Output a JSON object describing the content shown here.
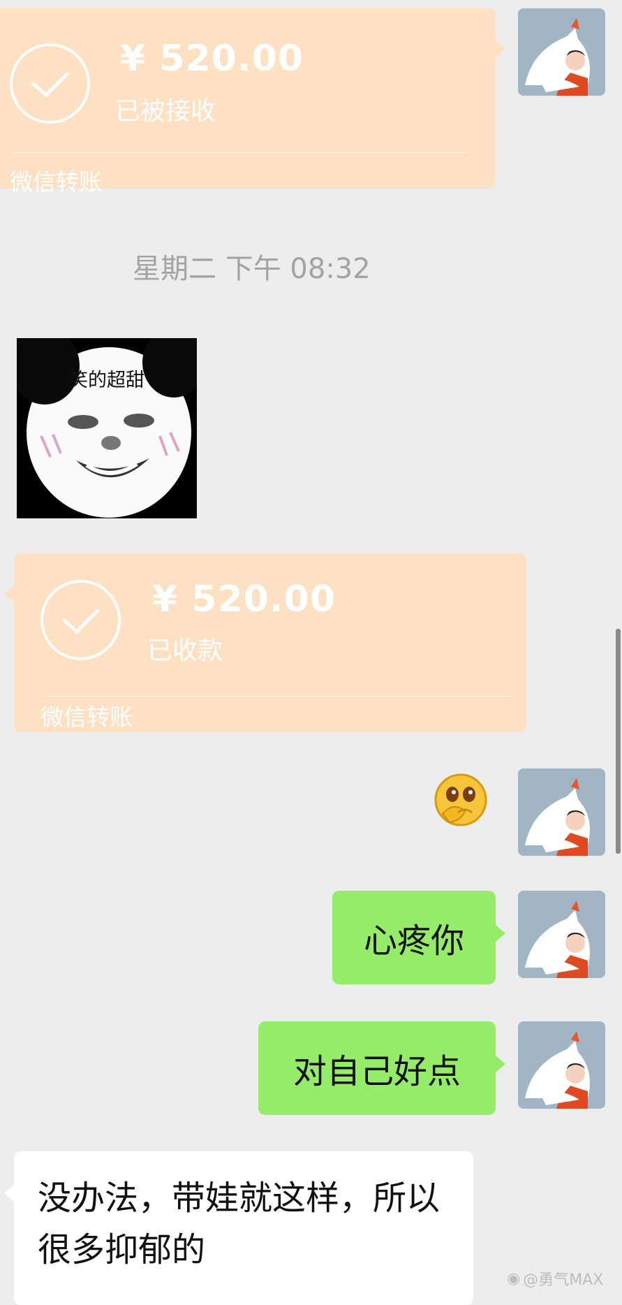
{
  "transfer_sent": {
    "amount": "¥ 520.00",
    "status": "已被接收",
    "footer": "微信转账"
  },
  "timestamp": "星期二 下午 08:32",
  "sticker": {
    "caption": "笑的超甜"
  },
  "transfer_received": {
    "amount": "¥ 520.00",
    "status": "已收款",
    "footer": "微信转账"
  },
  "messages": {
    "emoji_name": "facepalm-peek-emoji",
    "msg1": "心疼你",
    "msg2": "对自己好点",
    "reply": "没办法，带娃就这样，所以很多抑郁的"
  },
  "watermark": "@勇气MAX",
  "colors": {
    "background": "#ededed",
    "transfer": "#fde1c2",
    "bubble_sent": "#95ec69",
    "bubble_received": "#ffffff"
  }
}
